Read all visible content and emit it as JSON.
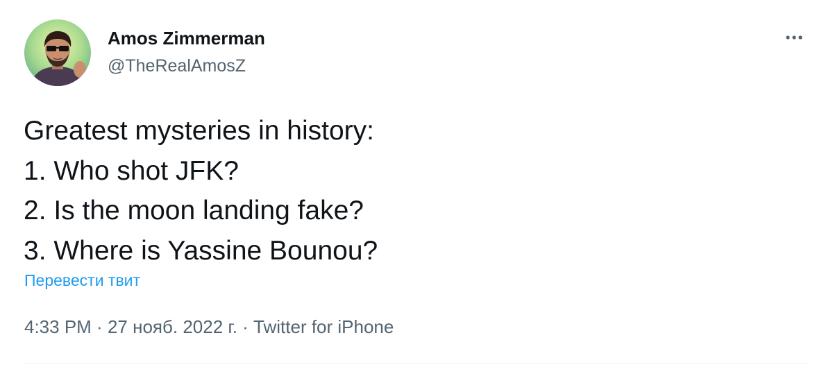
{
  "author": {
    "name": "Amos Zimmerman",
    "handle": "@TheRealAmosZ"
  },
  "tweet": {
    "lines": [
      "Greatest mysteries in history:",
      "1. Who shot JFK?",
      "2. Is the moon landing fake?",
      "3. Where is Yassine Bounou?"
    ],
    "translate_label": "Перевести твит"
  },
  "meta": {
    "time": "4:33 PM",
    "separator": " · ",
    "date": "27 нояб. 2022 г.",
    "source": "Twitter for iPhone"
  },
  "icons": {
    "more": "more-horizontal-icon",
    "avatar": "avatar-photo"
  },
  "colors": {
    "text_primary": "#0f1419",
    "text_secondary": "#536471",
    "link": "#1d9bf0",
    "divider": "#eff3f4"
  }
}
